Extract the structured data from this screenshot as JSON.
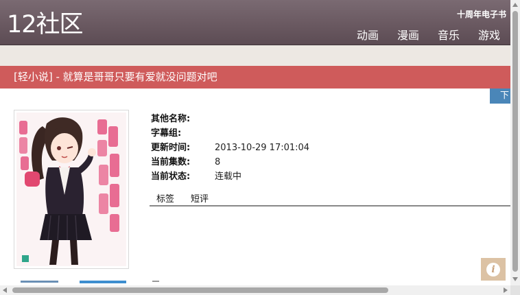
{
  "header": {
    "logo": "12社区",
    "ebook_link": "十周年电子书",
    "nav": [
      "动画",
      "漫画",
      "音乐",
      "游戏"
    ]
  },
  "title_bar": {
    "text": "[轻小说] - 就算是哥哥只要有爱就没问题对吧"
  },
  "download_tab": {
    "label": "下"
  },
  "details": [
    {
      "label": "其他名称:",
      "value": ""
    },
    {
      "label": "字幕组:",
      "value": ""
    },
    {
      "label": "更新时间:",
      "value": "2013-10-29 17:01:04"
    },
    {
      "label": "当前集数:",
      "value": "8"
    },
    {
      "label": "当前状态:",
      "value": "连载中"
    }
  ],
  "tabs": [
    "标签",
    "短评"
  ],
  "colors": {
    "header": "#6a5961",
    "title_bar": "#cf5b5b",
    "band": "#ede8e3",
    "download_tab": "#4a86b8",
    "info_button": "#dcc2a4"
  },
  "icons": {
    "info_button": "info-icon"
  }
}
